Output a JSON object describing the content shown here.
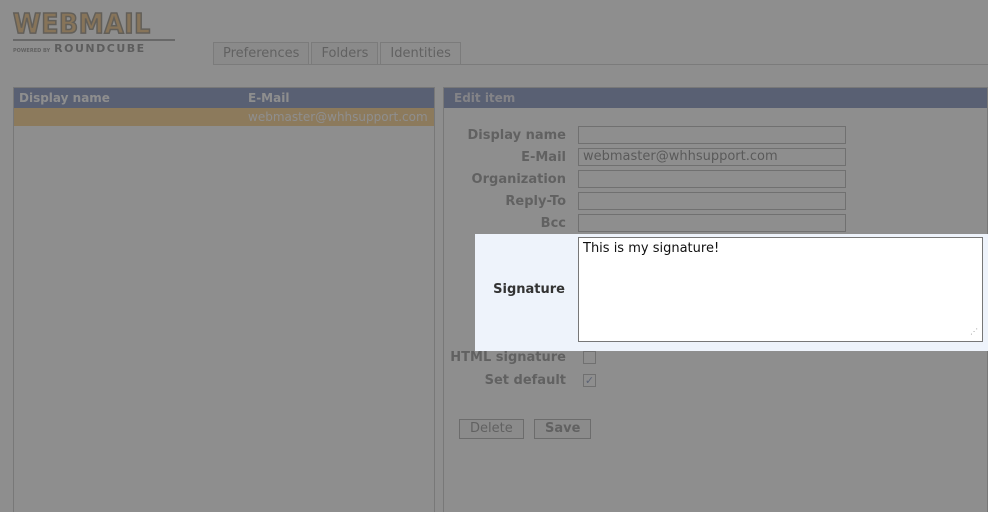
{
  "logo": {
    "main": "WEBMAIL",
    "powered": "powered by",
    "brand": "ROUNDCUBE"
  },
  "tabs": [
    {
      "label": "Preferences",
      "active": false
    },
    {
      "label": "Folders",
      "active": false
    },
    {
      "label": "Identities",
      "active": true
    }
  ],
  "list": {
    "columns": {
      "name": "Display name",
      "email": "E-Mail"
    },
    "rows": [
      {
        "name": "",
        "email": "webmaster@whhsupport.com",
        "selected": true
      }
    ]
  },
  "edit": {
    "title": "Edit item",
    "fields": {
      "display_name": {
        "label": "Display name",
        "value": ""
      },
      "email": {
        "label": "E-Mail",
        "value": "webmaster@whhsupport.com"
      },
      "organization": {
        "label": "Organization",
        "value": ""
      },
      "reply_to": {
        "label": "Reply-To",
        "value": ""
      },
      "bcc": {
        "label": "Bcc",
        "value": ""
      }
    },
    "signature": {
      "label": "Signature",
      "value": "This is my signature!"
    },
    "html_signature": {
      "label": "HTML signature",
      "checked": false
    },
    "set_default": {
      "label": "Set default",
      "checked": true
    },
    "buttons": {
      "delete": "Delete",
      "save": "Save"
    }
  },
  "colors": {
    "header_blue": "#0f2d84",
    "selected_row": "#f5a21c",
    "logo_orange": "#e0890f",
    "highlight_bg": "#eef3fb"
  }
}
